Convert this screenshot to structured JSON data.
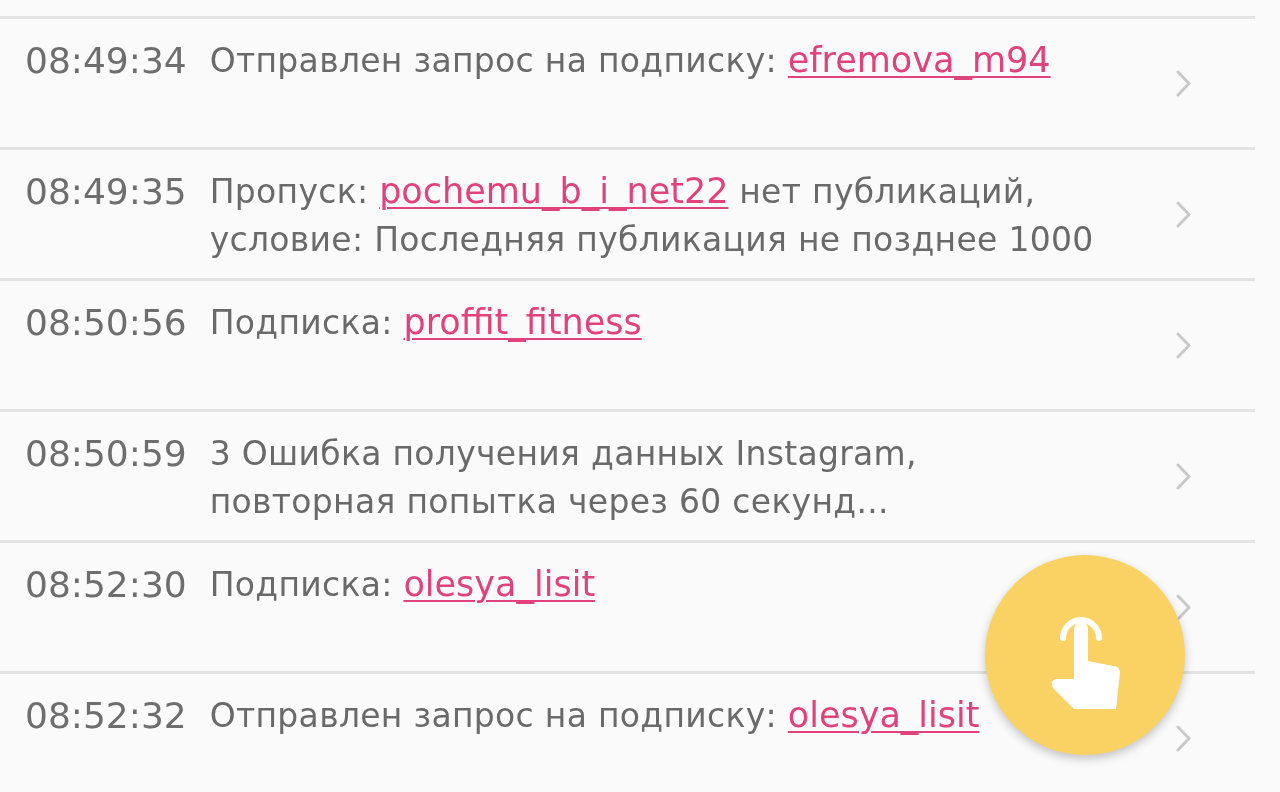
{
  "entries": [
    {
      "time": "08:49:34",
      "message": [
        [
          {
            "kind": "text",
            "text": "Отправлен запрос на подписку: "
          },
          {
            "kind": "link",
            "text": "efremova_m94"
          }
        ]
      ]
    },
    {
      "time": "08:49:35",
      "message": [
        [
          {
            "kind": "text",
            "text": "Пропуск: "
          },
          {
            "kind": "link",
            "text": "pochemu_b_i_net22"
          },
          {
            "kind": "text",
            "text": " нет публикаций,"
          }
        ],
        [
          {
            "kind": "text",
            "text": "условие: Последняя публикация не позднее 1000"
          }
        ]
      ]
    },
    {
      "time": "08:50:56",
      "message": [
        [
          {
            "kind": "text",
            "text": "Подписка: "
          },
          {
            "kind": "link",
            "text": "proffit_fitness"
          }
        ]
      ]
    },
    {
      "time": "08:50:59",
      "message": [
        [
          {
            "kind": "text",
            "text": "3 Ошибка получения данных Instagram,"
          }
        ],
        [
          {
            "kind": "text",
            "text": "повторная попытка через 60 секунд..."
          }
        ]
      ]
    },
    {
      "time": "08:52:30",
      "message": [
        [
          {
            "kind": "text",
            "text": "Подписка: "
          },
          {
            "kind": "link",
            "text": "olesya_lisit"
          }
        ]
      ]
    },
    {
      "time": "08:52:32",
      "message": [
        [
          {
            "kind": "text",
            "text": "Отправлен запрос на подписку: "
          },
          {
            "kind": "link",
            "text": "olesya_lisit"
          }
        ]
      ]
    }
  ]
}
